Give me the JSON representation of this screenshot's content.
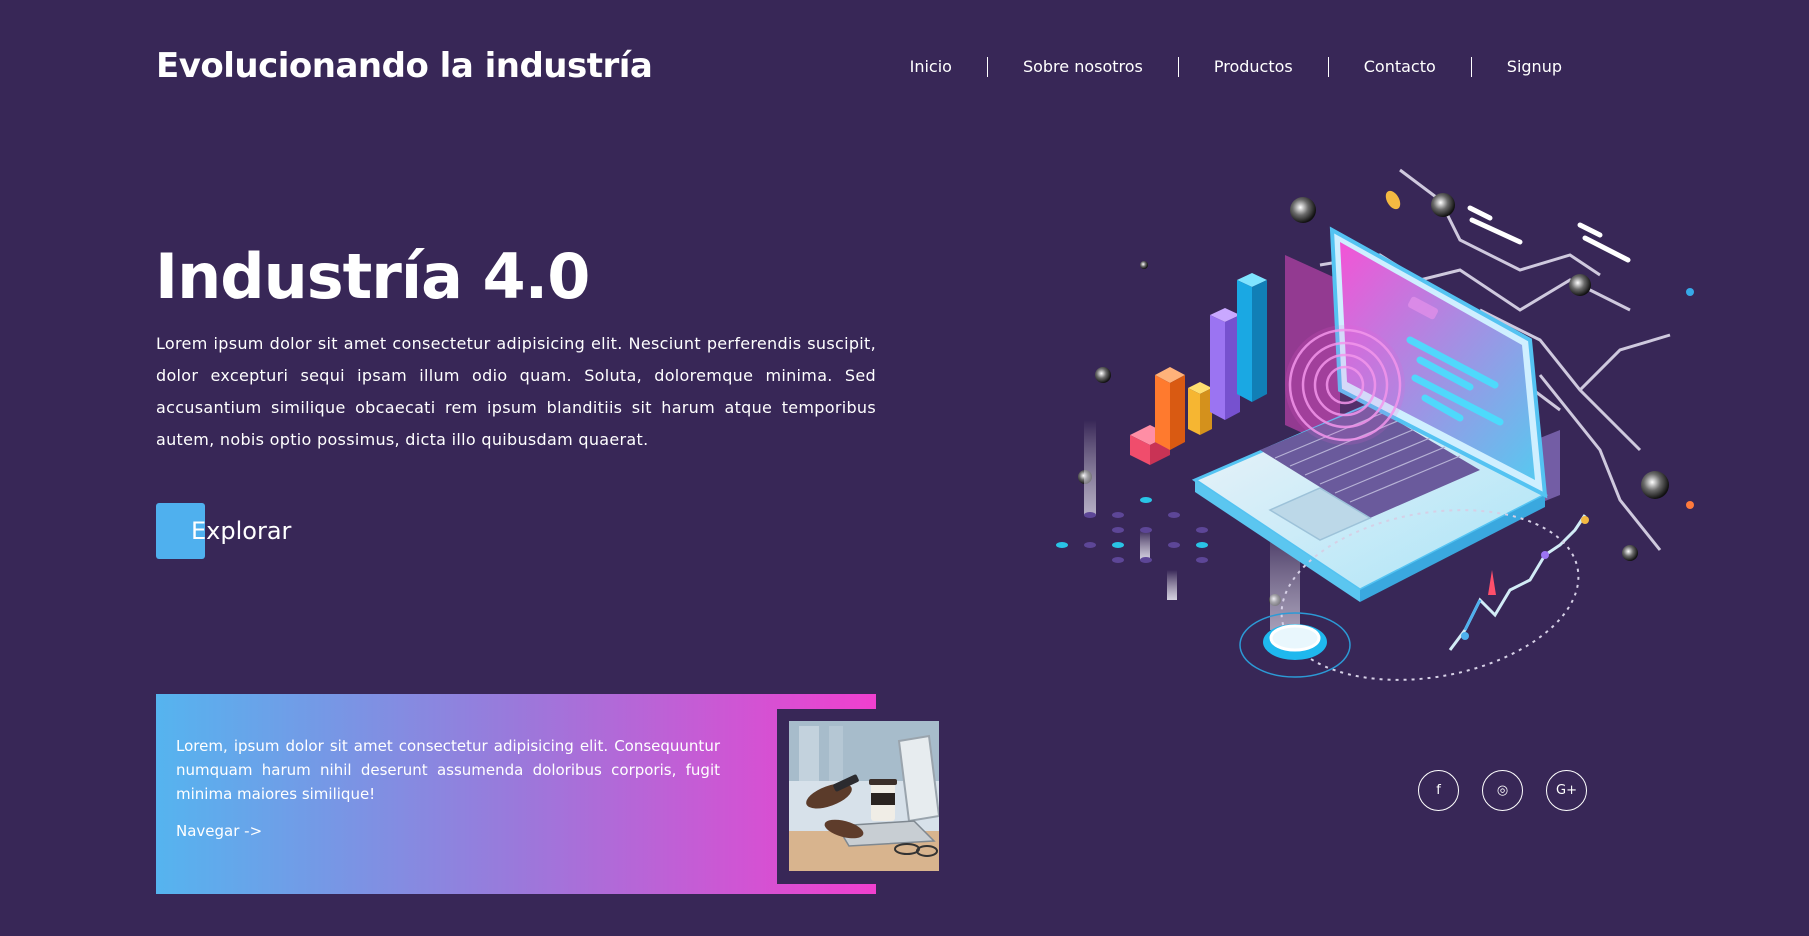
{
  "header": {
    "title": "Evolucionando la industría",
    "nav": [
      "Inicio",
      "Sobre nosotros",
      "Productos",
      "Contacto",
      "Signup"
    ]
  },
  "hero": {
    "title": "Industría 4.0",
    "text": "Lorem ipsum dolor sit amet consectetur adipisicing elit. Nesciunt perferendis suscipit, dolor excepturi sequi ipsam illum odio quam. Soluta, doloremque minima. Sed accusantium similique obcaecati rem ipsum blanditiis sit harum atque temporibus autem, nobis optio possimus, dicta illo quibusdam quaerat.",
    "button_label": "Explorar"
  },
  "card": {
    "text": "Lorem, ipsum dolor sit amet consectetur adipisicing elit. Consequuntur numquam harum nihil deserunt assumenda doloribus corporis, fugit minima maiores similique!",
    "link_label": "Navegar ->"
  },
  "socials": [
    {
      "icon": "facebook-icon",
      "glyph": "f"
    },
    {
      "icon": "instagram-icon",
      "glyph": "◎"
    },
    {
      "icon": "google-plus-icon",
      "glyph": "G+"
    }
  ],
  "colors": {
    "background": "#382757",
    "accent_blue": "#4fb0ee",
    "accent_pink": "#f03fcf"
  }
}
